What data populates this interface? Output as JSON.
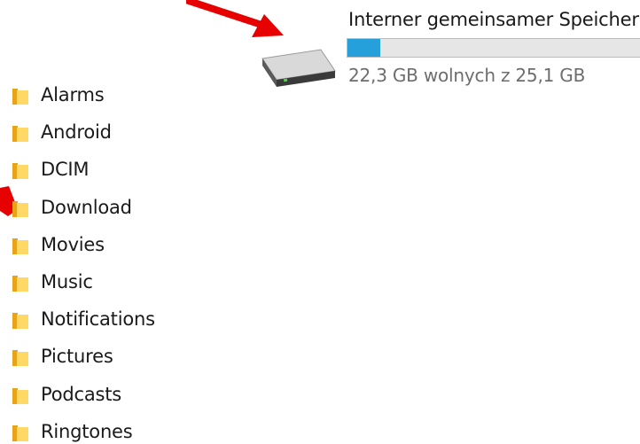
{
  "drive": {
    "name": "Interner gemeinsamer Speicher",
    "free_text": "22,3 GB wolnych z 25,1 GB",
    "used_fraction": 0.11,
    "icon": "hard-drive-icon",
    "bar_color": "#26a0da"
  },
  "folders": [
    {
      "label": "Alarms",
      "icon": "folder-icon"
    },
    {
      "label": "Android",
      "icon": "folder-icon"
    },
    {
      "label": "DCIM",
      "icon": "folder-icon"
    },
    {
      "label": "Download",
      "icon": "folder-icon"
    },
    {
      "label": "Movies",
      "icon": "folder-icon"
    },
    {
      "label": "Music",
      "icon": "folder-icon"
    },
    {
      "label": "Notifications",
      "icon": "folder-icon"
    },
    {
      "label": "Pictures",
      "icon": "folder-icon"
    },
    {
      "label": "Podcasts",
      "icon": "folder-icon"
    },
    {
      "label": "Ringtones",
      "icon": "folder-icon"
    }
  ],
  "annotation": {
    "arrow_color": "#e60000"
  }
}
